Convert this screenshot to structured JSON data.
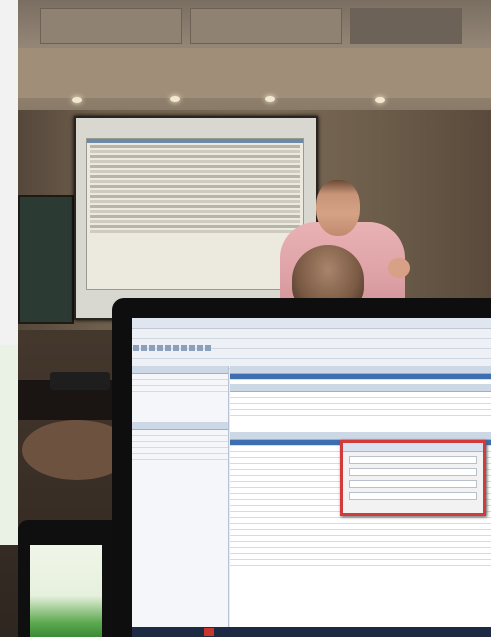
{
  "scene": {
    "projected_app_visible": true,
    "laptop_app_visible": true
  },
  "colors": {
    "wall": "#7a6a56",
    "presenter_shirt": "#e9b2b4",
    "dialog_border": "#d23b3b",
    "taskbar": "#1c2a44"
  },
  "icons": {
    "ceiling_lights": "ceiling-light-icon",
    "dialog_close": "close-icon"
  }
}
